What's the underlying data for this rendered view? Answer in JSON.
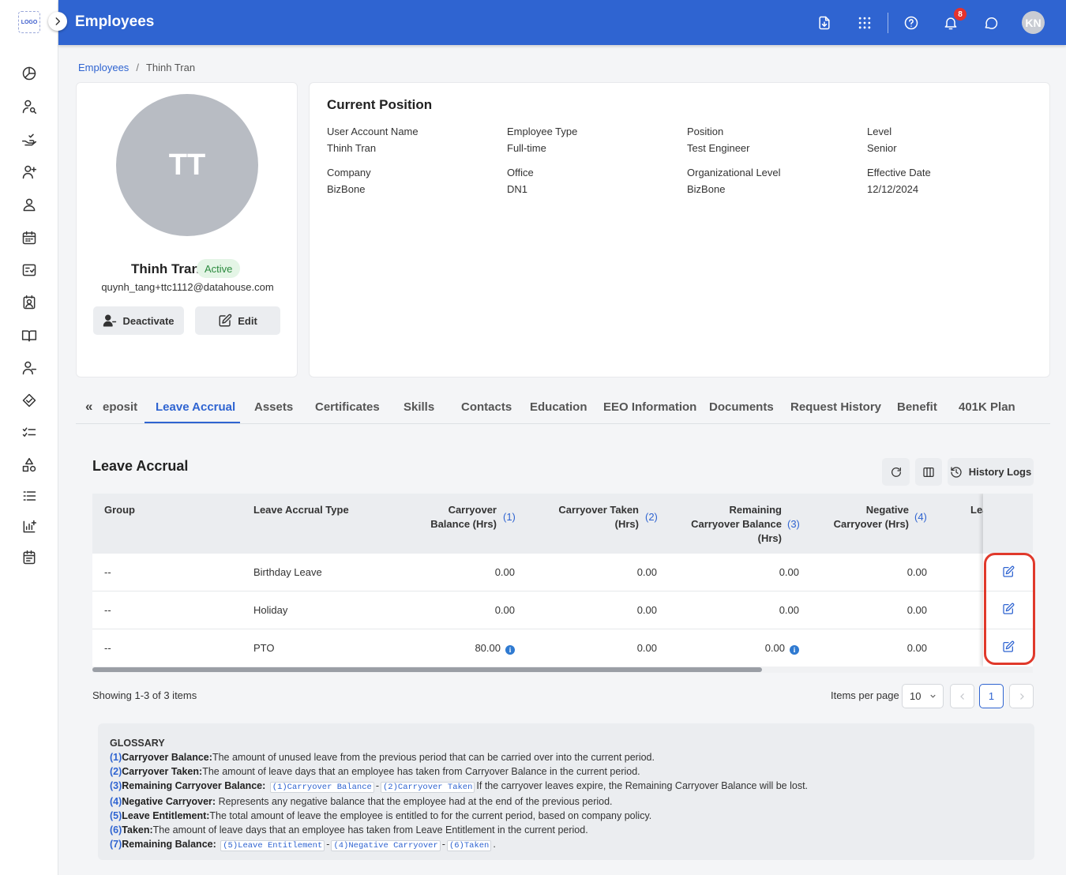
{
  "app": {
    "logo_text": "LOGO",
    "title": "Employees",
    "notification_count": "8",
    "user_initials": "KN"
  },
  "sidebar": {
    "items": [
      "dashboard-icon",
      "user-search-icon",
      "hand-check-icon",
      "user-add-icon",
      "user-icon",
      "calendar-icon",
      "checklist-icon",
      "contact-card-icon",
      "book-icon",
      "user-minus-icon",
      "handshake-icon",
      "task-list-icon",
      "shapes-icon",
      "ordered-list-icon",
      "chart-add-icon",
      "schedule-icon"
    ]
  },
  "breadcrumb": {
    "root": "Employees",
    "separator": "/",
    "current": "Thinh Tran"
  },
  "profile": {
    "initials": "TT",
    "name": "Thinh Tran",
    "status": "Active",
    "email": "quynh_tang+ttc1112@datahouse.com",
    "deactivate_label": "Deactivate",
    "edit_label": "Edit"
  },
  "position": {
    "title": "Current Position",
    "fields": [
      {
        "label": "User Account Name",
        "value": "Thinh Tran"
      },
      {
        "label": "Employee Type",
        "value": "Full-time"
      },
      {
        "label": "Position",
        "value": "Test Engineer"
      },
      {
        "label": "Level",
        "value": "Senior"
      },
      {
        "label": "Company",
        "value": "BizBone"
      },
      {
        "label": "Office",
        "value": "DN1"
      },
      {
        "label": "Organizational Level",
        "value": "BizBone"
      },
      {
        "label": "Effective Date",
        "value": "12/12/2024"
      }
    ]
  },
  "tabs": {
    "scroll_left": "«",
    "items": [
      "eposit",
      "Leave Accrual",
      "Assets",
      "Certificates",
      "Skills",
      "Contacts",
      "Education",
      "EEO Information",
      "Documents",
      "Request History",
      "Benefit",
      "401K Plan"
    ],
    "active": "Leave Accrual"
  },
  "leave_accrual": {
    "title": "Leave Accrual",
    "history_label": "History Logs",
    "columns": {
      "group": "Group",
      "type": "Leave Accrual Type",
      "carryover_balance": [
        "Carryover",
        "Balance (Hrs)"
      ],
      "carryover_balance_n": "(1)",
      "carryover_taken": [
        "Carryover Taken",
        "(Hrs)"
      ],
      "carryover_taken_n": "(2)",
      "remaining": [
        "Remaining",
        "Carryover Balance",
        "(Hrs)"
      ],
      "remaining_n": "(3)",
      "negative": [
        "Negative",
        "Carryover (Hrs)"
      ],
      "negative_n": "(4)",
      "partial": "Lea"
    },
    "rows": [
      {
        "group": "--",
        "type": "Birthday Leave",
        "carryover_balance": "0.00",
        "carryover_taken": "0.00",
        "remaining": "0.00",
        "negative": "0.00"
      },
      {
        "group": "--",
        "type": "Holiday",
        "carryover_balance": "0.00",
        "carryover_taken": "0.00",
        "remaining": "0.00",
        "negative": "0.00"
      },
      {
        "group": "--",
        "type": "PTO",
        "carryover_balance": "80.00",
        "carryover_taken": "0.00",
        "remaining": "0.00",
        "negative": "0.00"
      }
    ],
    "info_glyph": "i",
    "showing": "Showing 1-3 of 3 items",
    "items_per_page_label": "Items per page",
    "items_per_page": "10",
    "current_page": "1"
  },
  "glossary": {
    "title": "GLOSSARY",
    "items": [
      {
        "n": "(1)",
        "term": "Carryover Balance:",
        "text": "The amount of unused leave from the previous period that can be carried over into the current period."
      },
      {
        "n": "(2)",
        "term": "Carryover Taken:",
        "text": "The amount of leave days that an employee has taken from Carryover Balance in the current period."
      },
      {
        "n": "(3)",
        "term": "Remaining Carryover Balance:",
        "f1": "(1)Carryover Balance",
        "op1": "-",
        "f2": "(2)Carryover Taken",
        "text": "If the carryover leaves expire, the Remaining Carryover Balance will be lost."
      },
      {
        "n": "(4)",
        "term": "Negative Carryover:",
        "text": "Represents any negative balance that the employee had at the end of the previous period."
      },
      {
        "n": "(5)",
        "term": "Leave Entitlement:",
        "text": "The total amount of leave the employee is entitled to for the current period, based on company policy."
      },
      {
        "n": "(6)",
        "term": "Taken:",
        "text": "The amount of leave days that an employee has taken from Leave Entitlement in the current period."
      },
      {
        "n": "(7)",
        "term": "Remaining Balance:",
        "f1": "(5)Leave Entitlement",
        "op1": "-",
        "f2": "(4)Negative Carryover",
        "op2": "-",
        "f3": "(6)Taken",
        "end": "."
      }
    ]
  }
}
